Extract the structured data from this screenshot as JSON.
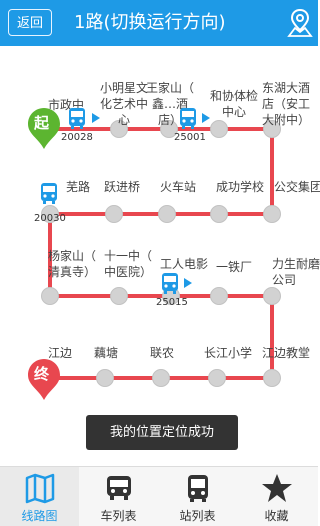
{
  "header": {
    "back_label": "返回",
    "title": "1路(切换运行方向)"
  },
  "route": {
    "start_badge": "起",
    "end_badge": "终",
    "stops": [
      "市政中",
      "小明星文化艺术中心",
      "王家山（鑫...（...酒店）",
      "和协体检中心",
      "东湖大酒店（安工大附中）",
      "芜路",
      "跃进桥",
      "火车站",
      "成功学校",
      "公交集团",
      "杨家山（清真寺）",
      "十一中（中医院）",
      "工人电影院",
      "一铁厂",
      "力生耐磨公司",
      "江边",
      "藕塘",
      "联农",
      "长江小学",
      "江边教堂"
    ],
    "buses": [
      "20028",
      "25001",
      "20030",
      "25015"
    ]
  },
  "toast": {
    "text": "我的位置定位成功"
  },
  "tabs": [
    {
      "label": "线路图",
      "icon": "map-icon"
    },
    {
      "label": "车列表",
      "icon": "bus-front-icon"
    },
    {
      "label": "站列表",
      "icon": "bus-icon"
    },
    {
      "label": "收藏",
      "icon": "star-icon"
    }
  ],
  "colors": {
    "header": "#1e9ae6",
    "route_line": "#e8474f",
    "start_badge": "#5cb530",
    "end_badge": "#e8474f"
  }
}
